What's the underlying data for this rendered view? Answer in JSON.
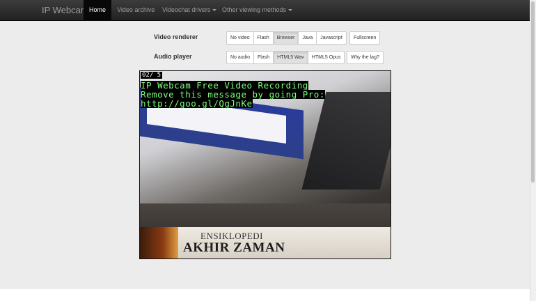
{
  "navbar": {
    "brand": "IP Webcam",
    "items": [
      {
        "label": "Home",
        "active": true
      },
      {
        "label": "Video archive"
      },
      {
        "label": "Videochat drivers"
      },
      {
        "label": "Other viewing methods"
      }
    ]
  },
  "video_renderer": {
    "label": "Video renderer",
    "options": [
      "No video",
      "Flash",
      "Browser",
      "Java",
      "Javascript"
    ],
    "selected": "Browser",
    "fullscreen": "Fullscreen"
  },
  "audio_player": {
    "label": "Audio player",
    "options": [
      "No audio",
      "Flash",
      "HTML5 Wav",
      "HTML5 Opus"
    ],
    "selected": "HTML5 Wav",
    "lag": "Why the lag?"
  },
  "video": {
    "timestamp": "02/    5",
    "overlay": {
      "line1": "IP Webcam Free Video Recording",
      "line2": "Remove this message by going Pro:",
      "line3": "http://goo.gl/QgJnKe"
    },
    "book_line1": "ENSIKLOPEDI",
    "book_line2": "AKHIR ZAMAN"
  },
  "colors": {
    "navbar_bg": "#222222",
    "overlay_text": "#7dff7d",
    "page_bg": "#ececec"
  }
}
